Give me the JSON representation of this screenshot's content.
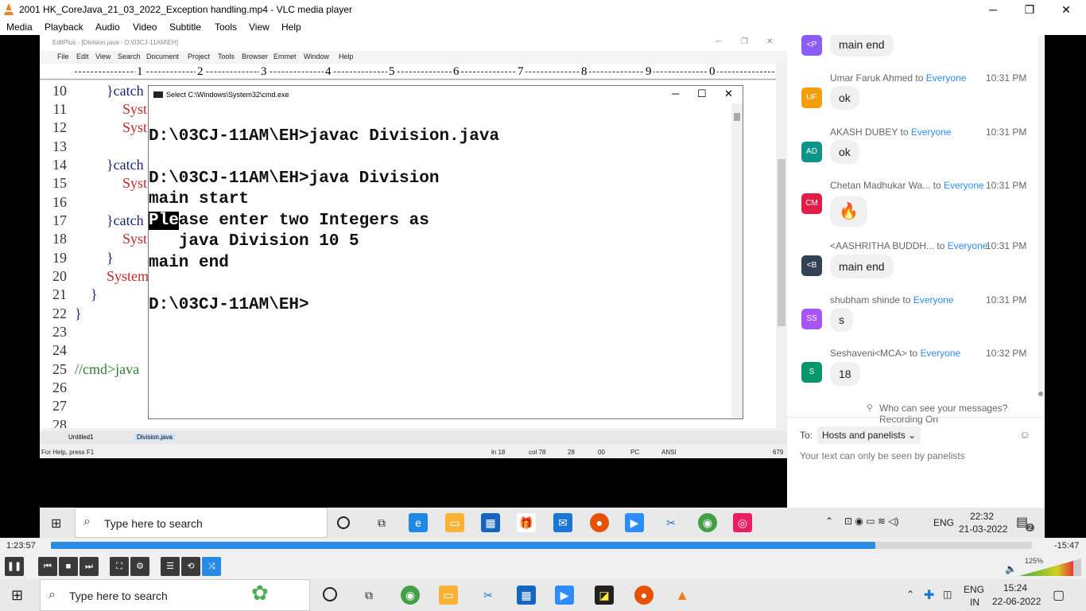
{
  "vlc": {
    "title": "2001 HK_CoreJava_21_03_2022_Exception handling.mp4 - VLC media player",
    "menu": [
      "Media",
      "Playback",
      "Audio",
      "Video",
      "Subtitle",
      "Tools",
      "View",
      "Help"
    ],
    "elapsed": "1:23:57",
    "remaining": "-15:47",
    "progress_fraction": 0.84,
    "volume": "125%"
  },
  "editplus": {
    "title": "EditPlus - [Division.java - D:\\03CJ-11AM\\EH]",
    "menu": [
      "File",
      "Edit",
      "View",
      "Search",
      "Document",
      "Project",
      "Tools",
      "Browser",
      "Emmet",
      "Window",
      "Help"
    ],
    "ruler": [
      "1",
      "2",
      "3",
      "4",
      "5",
      "6",
      "7",
      "8",
      "9",
      "0"
    ],
    "lines": [
      {
        "n": "10",
        "text": "}catch"
      },
      {
        "n": "11",
        "text": "Syst"
      },
      {
        "n": "12",
        "text": "Syst"
      },
      {
        "n": "13",
        "text": ""
      },
      {
        "n": "14",
        "text": "}catch"
      },
      {
        "n": "15",
        "text": "Syst"
      },
      {
        "n": "16",
        "text": ""
      },
      {
        "n": "17",
        "text": "}catch"
      },
      {
        "n": "18",
        "text": "Syst"
      },
      {
        "n": "19",
        "text": "}"
      },
      {
        "n": "20",
        "text": "System"
      },
      {
        "n": "21",
        "text": "}"
      },
      {
        "n": "22",
        "text": "}"
      },
      {
        "n": "23",
        "text": ""
      },
      {
        "n": "24",
        "text": ""
      },
      {
        "n": "25",
        "text": "//cmd>java"
      },
      {
        "n": "26",
        "text": ""
      },
      {
        "n": "27",
        "text": ""
      },
      {
        "n": "28",
        "text": ""
      }
    ],
    "tabs": [
      "Untitled1",
      "Division.java"
    ],
    "status": {
      "help": "For Help, press F1",
      "ln": "ln 18",
      "col": "col 78",
      "v1": "28",
      "v2": "00",
      "mode": "PC",
      "enc": "ANSI",
      "size": "679"
    }
  },
  "cmd": {
    "title": "Select C:\\Windows\\System32\\cmd.exe",
    "lines": [
      "D:\\03CJ-11AM\\EH>javac Division.java",
      "",
      "D:\\03CJ-11AM\\EH>java Division",
      "main start",
      "ase enter two Integers as",
      "   java Division 10 5",
      "main end",
      "",
      "D:\\03CJ-11AM\\EH>"
    ],
    "selected": "Ple"
  },
  "chat": {
    "top_message": {
      "initials": "<P",
      "text": "main end",
      "color": "#8b5cf6"
    },
    "messages": [
      {
        "from": "Umar Faruk Ahmed",
        "to": "to",
        "audience": "Everyone",
        "time": "10:31 PM",
        "initials": "UF",
        "color": "#f59e0b",
        "text": "ok"
      },
      {
        "from": "AKASH DUBEY",
        "to": "to",
        "audience": "Everyone",
        "time": "10:31 PM",
        "initials": "AD",
        "color": "#0d9488",
        "text": "ok"
      },
      {
        "from": "Chetan Madhukar Wa...",
        "to": "to",
        "audience": "Everyone",
        "time": "10:31 PM",
        "initials": "CM",
        "color": "#e11d48",
        "text": "🔥"
      },
      {
        "from": "<AASHRITHA BUDDH...",
        "to": "to",
        "audience": "Everyone",
        "time": "10:31 PM",
        "initials": "<B",
        "color": "#334155",
        "text": "main end"
      },
      {
        "from": "shubham shinde",
        "to": "to",
        "audience": "Everyone",
        "time": "10:31 PM",
        "initials": "SS",
        "color": "#a855f7",
        "text": "s"
      },
      {
        "from": "Seshaveni<MCA>",
        "to": "to",
        "audience": "Everyone",
        "time": "10:32 PM",
        "initials": "S",
        "color": "#059669",
        "text": "18"
      }
    ],
    "info": "Who can see your messages? Recording On",
    "to_label": "To:",
    "to_value": "Hosts and panelists",
    "note": "Your text can only be seen by panelists"
  },
  "captured_taskbar": {
    "search": "Type here to search",
    "lang": "ENG",
    "time": "22:32",
    "date": "21-03-2022",
    "notif": "2"
  },
  "taskbar": {
    "search": "Type here to search",
    "lang": "ENG",
    "region": "IN",
    "time": "15:24",
    "date": "22-06-2022"
  }
}
